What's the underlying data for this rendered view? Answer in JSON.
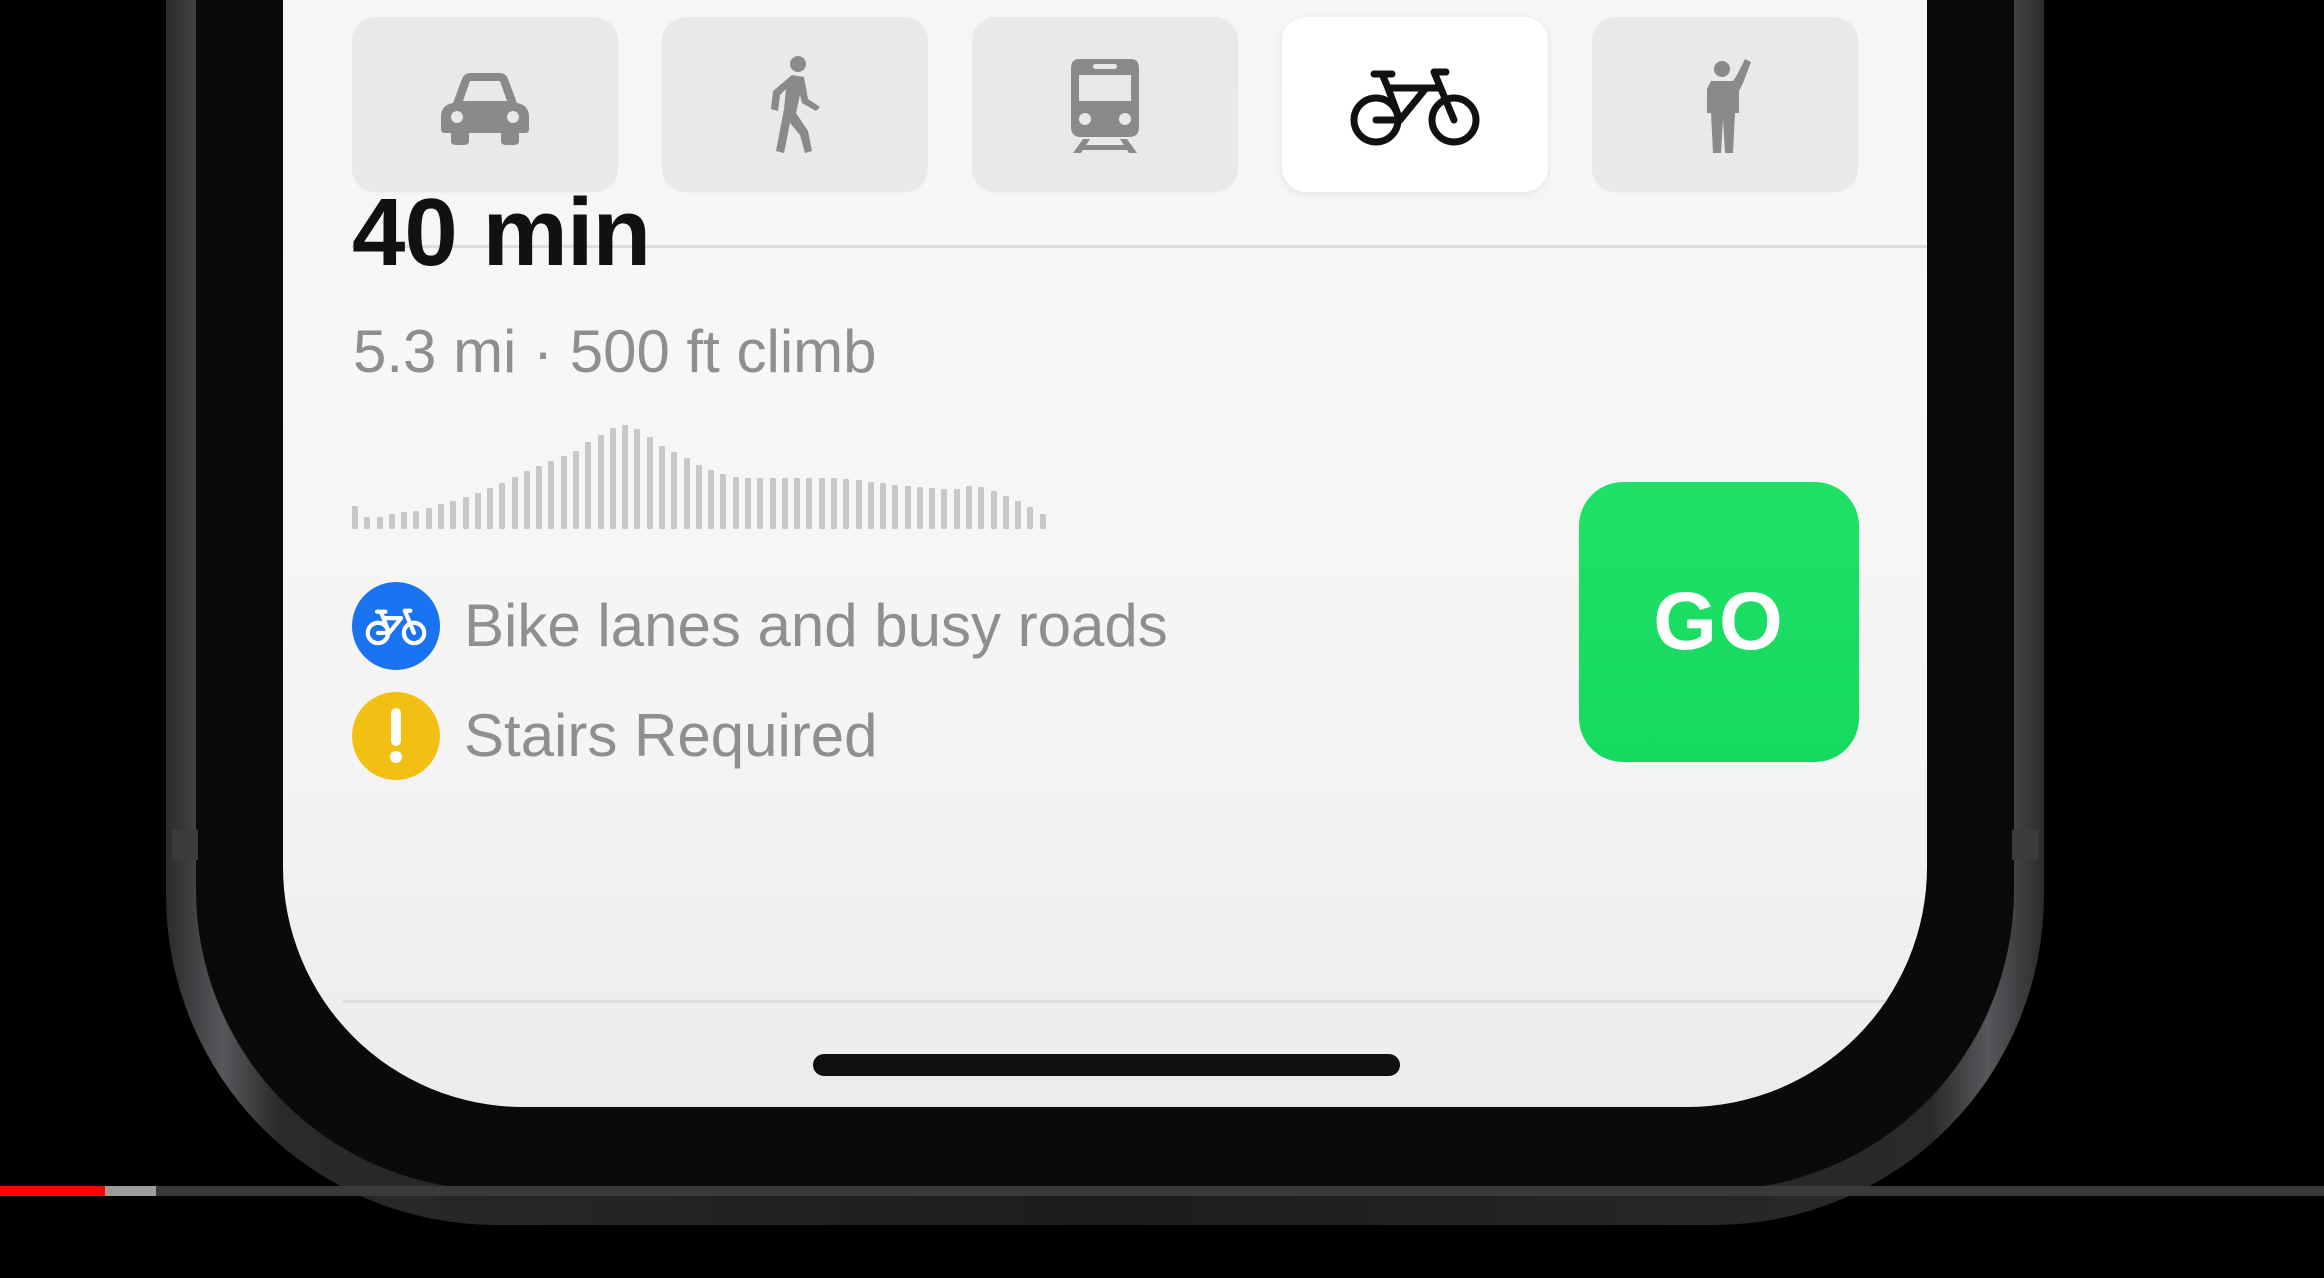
{
  "transport_modes": [
    {
      "name": "Drive",
      "icon": "car-icon",
      "selected": false
    },
    {
      "name": "Walk",
      "icon": "walking-person-icon",
      "selected": false
    },
    {
      "name": "Transit",
      "icon": "train-icon",
      "selected": false
    },
    {
      "name": "Cycle",
      "icon": "bicycle-icon",
      "selected": true
    },
    {
      "name": "Ride Share",
      "icon": "hailing-person-icon",
      "selected": false
    }
  ],
  "route": {
    "duration": "40 min",
    "distance_climb": "5.3 mi · 500 ft climb",
    "elevation_profile": [
      0.22,
      0.12,
      0.12,
      0.14,
      0.16,
      0.17,
      0.2,
      0.24,
      0.27,
      0.31,
      0.35,
      0.39,
      0.44,
      0.5,
      0.56,
      0.61,
      0.65,
      0.7,
      0.75,
      0.84,
      0.9,
      0.97,
      1.0,
      0.96,
      0.88,
      0.8,
      0.74,
      0.68,
      0.62,
      0.57,
      0.53,
      0.5,
      0.49,
      0.49,
      0.49,
      0.49,
      0.49,
      0.49,
      0.49,
      0.49,
      0.48,
      0.47,
      0.45,
      0.44,
      0.42,
      0.41,
      0.4,
      0.39,
      0.38,
      0.38,
      0.41,
      0.4,
      0.37,
      0.32,
      0.27,
      0.21,
      0.14
    ]
  },
  "advisories": [
    {
      "icon": "bicycle-icon",
      "text": "Bike lanes and busy roads",
      "color": "#1a73f0"
    },
    {
      "icon": "exclamation-icon",
      "text": "Stairs Required",
      "color": "#f2c012"
    }
  ],
  "go_button": {
    "label": "GO",
    "color": "#19dc63"
  },
  "video_progress": {
    "played": 0.045,
    "buffered": 0.067
  }
}
